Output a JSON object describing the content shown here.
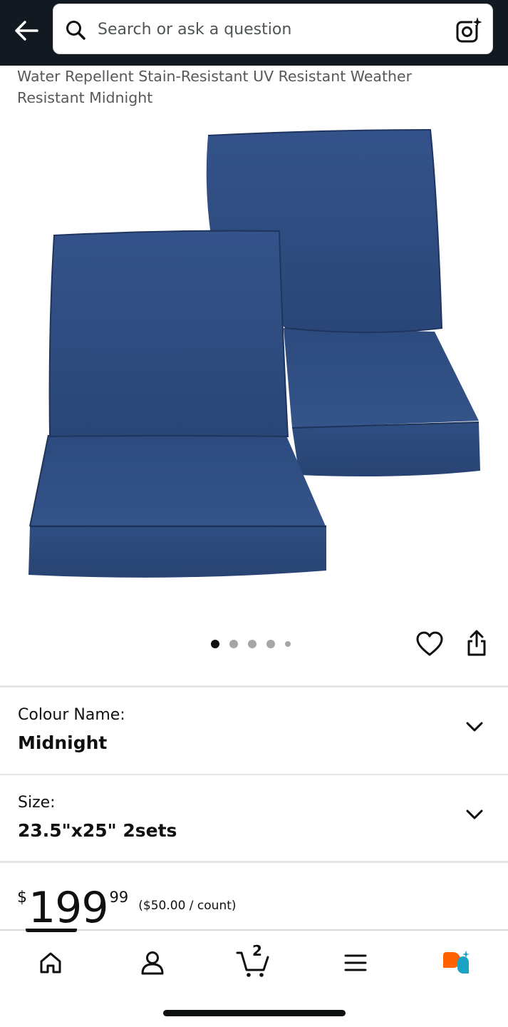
{
  "header": {
    "back_icon": "arrow-left-icon",
    "search_placeholder": "Search or ask a question",
    "search_icon": "search-icon",
    "camera_icon": "camera-lens-icon"
  },
  "product": {
    "title": "Water Repellent Stain-Resistant UV Resistant Weather Resistant Midnight",
    "image_color": "#2f4c7c",
    "carousel": {
      "total_dots": 5,
      "active_index": 0
    }
  },
  "options": {
    "colour": {
      "label": "Colour Name:",
      "value": "Midnight"
    },
    "size": {
      "label": "Size:",
      "value": "23.5\"x25\" 2sets"
    }
  },
  "price": {
    "symbol": "$",
    "whole": "199",
    "fraction": "99",
    "unit_price": "($50.00 / count)"
  },
  "bottom_nav": {
    "items": [
      "home-icon",
      "account-icon",
      "cart-icon",
      "menu-icon",
      "rufus-assistant-icon"
    ],
    "cart_count": "2",
    "active": "home"
  },
  "colors": {
    "header_bg": "#131921",
    "text": "#0f1111",
    "muted_text": "#565959",
    "rufus_orange": "#ff6200",
    "rufus_teal": "#1ba3c6"
  }
}
